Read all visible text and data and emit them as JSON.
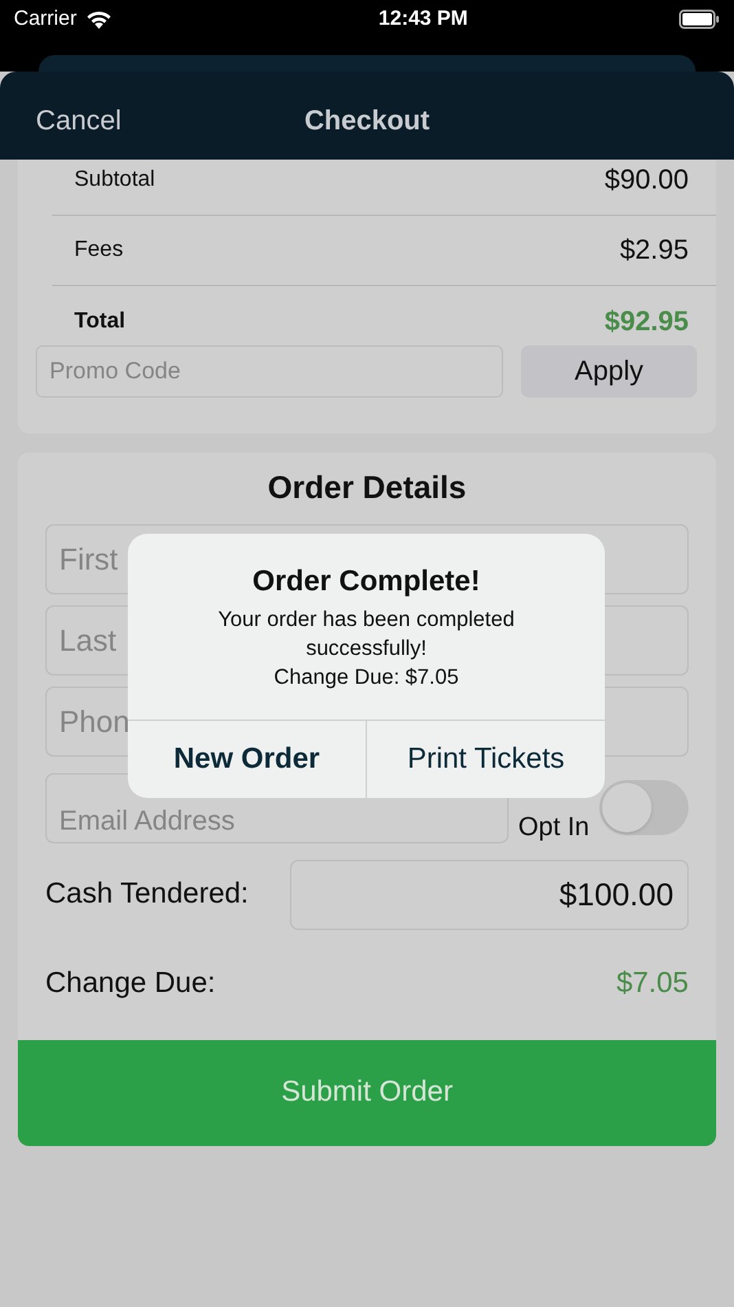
{
  "status_bar": {
    "carrier": "Carrier",
    "time": "12:43 PM"
  },
  "nav": {
    "cancel": "Cancel",
    "title": "Checkout"
  },
  "summary": {
    "rows": [
      {
        "label": "Subtotal",
        "value": "$90.00",
        "kind": "plain"
      },
      {
        "label": "Fees",
        "value": "$2.95",
        "kind": "plain"
      },
      {
        "label": "Total",
        "value": "$92.95",
        "kind": "total"
      }
    ],
    "promo": {
      "placeholder": "Promo Code"
    },
    "apply": "Apply"
  },
  "order": {
    "title": "Order Details",
    "fields": [
      {
        "placeholder": "First"
      },
      {
        "placeholder": "Last"
      },
      {
        "placeholder": "Phon"
      }
    ],
    "email": {
      "placeholder": "Email Address"
    },
    "opt_in": {
      "label": "Opt In",
      "on": false
    },
    "cash": {
      "label": "Cash Tendered:",
      "value": "$100.00"
    },
    "change": {
      "label": "Change Due:",
      "value": "$7.05"
    },
    "submit": "Submit Order"
  },
  "alert": {
    "title": "Order Complete!",
    "message": "Your order has been completed successfully!",
    "detail": "Change Due: $7.05",
    "buttons": [
      {
        "label": "New Order",
        "kind": "preferred"
      },
      {
        "label": "Print Tickets",
        "kind": "default"
      }
    ]
  }
}
